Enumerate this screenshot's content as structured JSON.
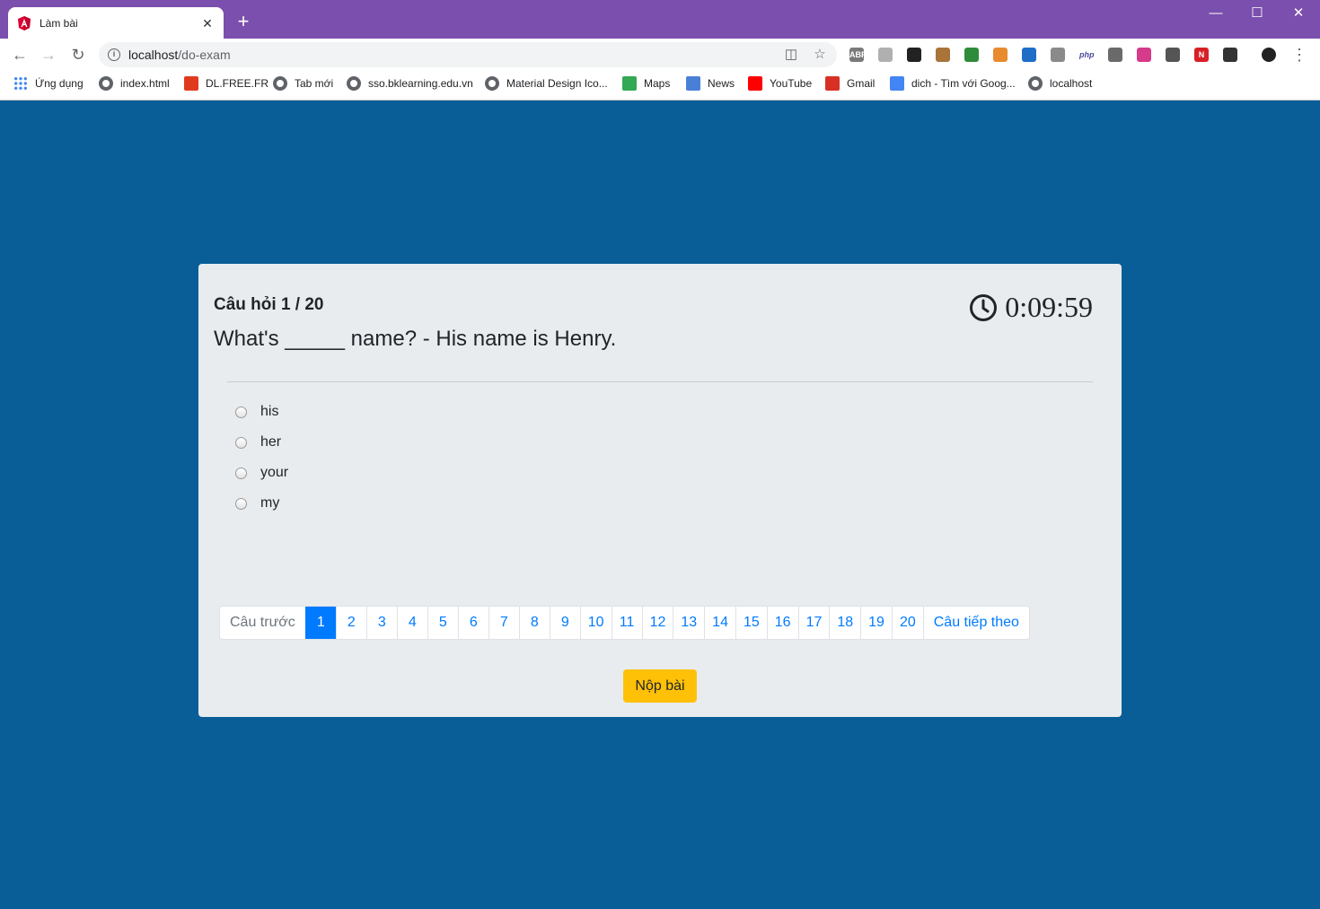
{
  "browser": {
    "tab_title": "Làm bài",
    "url_host": "localhost",
    "url_path": "/do-exam",
    "bookmarks": [
      {
        "label": "Ứng dụng",
        "icon": "apps-grid-icon"
      },
      {
        "label": "index.html",
        "icon": "globe-icon"
      },
      {
        "label": "DL.FREE.FR",
        "icon": "flash-icon"
      },
      {
        "label": "Tab mới",
        "icon": "globe-icon"
      },
      {
        "label": "sso.bklearning.edu.vn",
        "icon": "globe-icon"
      },
      {
        "label": "Material Design Ico...",
        "icon": "globe-icon"
      },
      {
        "label": "Maps",
        "icon": "maps-icon"
      },
      {
        "label": "News",
        "icon": "news-icon"
      },
      {
        "label": "YouTube",
        "icon": "youtube-icon"
      },
      {
        "label": "Gmail",
        "icon": "gmail-icon"
      },
      {
        "label": "dich - Tìm với Goog...",
        "icon": "google-icon"
      },
      {
        "label": "localhost",
        "icon": "globe-icon"
      }
    ],
    "extensions": [
      {
        "name": "abp-extension",
        "text": "ABP",
        "color": "#7a7a7a"
      },
      {
        "name": "pdf-extension",
        "text": "",
        "color": "#b0b0b0"
      },
      {
        "name": "tampermonkey-extension",
        "text": "",
        "color": "#222222"
      },
      {
        "name": "cookie-extension",
        "text": "",
        "color": "#a8743a"
      },
      {
        "name": "idm-extension",
        "text": "",
        "color": "#2e8b3a"
      },
      {
        "name": "screenshot-extension",
        "text": "",
        "color": "#e88a2e"
      },
      {
        "name": "chat-extension",
        "text": "",
        "color": "#1e6ec8"
      },
      {
        "name": "settings-extension",
        "text": "",
        "color": "#8a8a8a"
      },
      {
        "name": "php-extension",
        "text": "php",
        "color": "#ffffff"
      },
      {
        "name": "eyedropper-extension",
        "text": "",
        "color": "#6a6a6a"
      },
      {
        "name": "color-wheel-extension",
        "text": "",
        "color": "#d63a8a"
      },
      {
        "name": "code-extension",
        "text": "",
        "color": "#555555"
      },
      {
        "name": "netflix-extension",
        "text": "N",
        "color": "#d81f26"
      },
      {
        "name": "sync-extension",
        "text": "",
        "color": "#333333"
      }
    ]
  },
  "exam": {
    "counter": "Câu hỏi 1 / 20",
    "question": "What's _____ name? - His name is Henry.",
    "timer": "0:09:59",
    "options": [
      "his",
      "her",
      "your",
      "my"
    ],
    "pagination": {
      "prev": "Câu trước",
      "next": "Câu tiếp theo",
      "pages": [
        "1",
        "2",
        "3",
        "4",
        "5",
        "6",
        "7",
        "8",
        "9",
        "10",
        "11",
        "12",
        "13",
        "14",
        "15",
        "16",
        "17",
        "18",
        "19",
        "20"
      ],
      "active": "1"
    },
    "submit": "Nộp bài"
  },
  "colors": {
    "page_background": "#0a5e98",
    "titlebar": "#7b4fad",
    "primary": "#007bff",
    "submit": "#ffc107"
  }
}
